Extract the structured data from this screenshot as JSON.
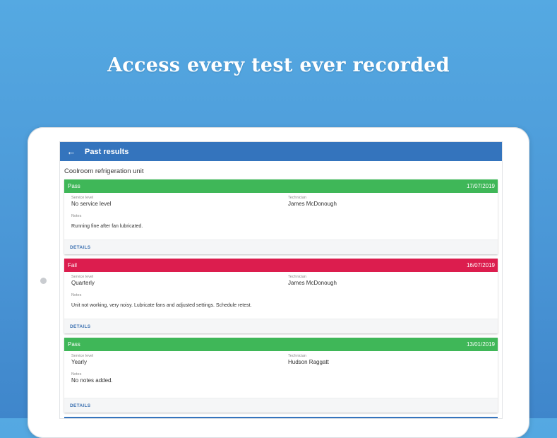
{
  "headline": "Access every test ever recorded",
  "colors": {
    "appbar": "#3474bd",
    "pass": "#3fb758",
    "fail": "#dc1d4e"
  },
  "appbar": {
    "back_icon": "arrow-left-icon",
    "back_glyph": "←",
    "title": "Past results"
  },
  "unit_title": "Coolroom refrigeration unit",
  "labels": {
    "service_level": "Service level",
    "technician": "Technician",
    "notes": "Notes",
    "details": "DETAILS"
  },
  "results": [
    {
      "status": "Pass",
      "date": "17/07/2019",
      "service_level": "No service level",
      "technician": "James McDonough",
      "notes": "Running fine after fan lubricated."
    },
    {
      "status": "Fail",
      "date": "16/07/2019",
      "service_level": "Quarterly",
      "technician": "James McDonough",
      "notes": "Unit not working, very noisy.  Lubricate fans and adjusted settings.  Schedule retest."
    },
    {
      "status": "Pass",
      "date": "13/01/2019",
      "service_level": "Yearly",
      "technician": "Hudson Raggatt",
      "notes": "No notes added."
    }
  ]
}
